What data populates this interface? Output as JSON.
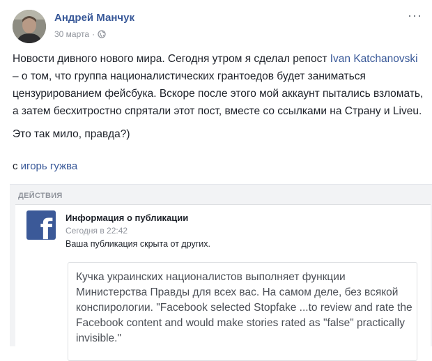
{
  "post": {
    "author": "Андрей Манчук",
    "date": "30 марта",
    "separator": "·",
    "privacy_icon": "globe-icon",
    "more_icon": "more-options-icon",
    "more_label": "···",
    "paragraph1_before_link": "Новости дивного нового мира. Сегодня утром я сделал репост ",
    "paragraph1_link": "Ivan Katchanovski",
    "paragraph1_after_link": " – о том, что группа националистических грантоедов будет заниматься цензурированием фейсбука. Вскоре после этого мой аккаунт пытались взломать, а затем бесхитростно спрятали этот пост, вместе со ссылками на Страну и Liveu.",
    "paragraph2": "Это так мило, правда?)",
    "with_prefix": "с ",
    "with_link": "игорь гужва"
  },
  "actions": {
    "label": "ДЕЙСТВИЯ",
    "notice": {
      "logo_icon": "facebook-logo-icon",
      "logo_letter": "f",
      "title": "Информация о публикации",
      "time": "Сегодня в 22:42",
      "text": "Ваша публикация скрыта от других."
    },
    "quote": "Кучка украинских националистов выполняет функции Министерства Правды для всех вас. На самом деле, без всякой конспирологии. \"Facebook selected Stopfake ...to review and rate the Facebook content and would make stories rated as \"false\" practically invisible.\""
  },
  "colors": {
    "link": "#385898",
    "facebook_blue": "#3b5998",
    "secondary_text": "#90949c",
    "panel_bg": "#f2f3f5"
  }
}
